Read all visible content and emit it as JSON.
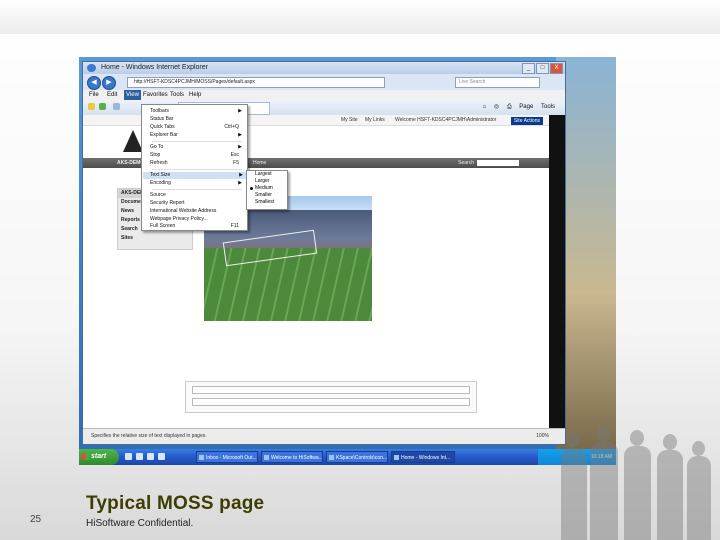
{
  "slide": {
    "title": "Typical MOSS page",
    "number": "25",
    "footer": "HiSoftware Confidential."
  },
  "browser": {
    "title": "Home - Windows Internet Explorer",
    "address": "http://HSFT-KDSC4PCJMH/MOSS/Pages/default.aspx",
    "search_placeholder": "Live Search",
    "window_buttons": [
      "_",
      "□",
      "X"
    ],
    "menubar": [
      "File",
      "Edit",
      "View",
      "Favorites",
      "Tools",
      "Help"
    ],
    "active_menu": "View",
    "toolbar": {
      "page": "Page",
      "tools": "Tools"
    },
    "status_text": "Specifies the relative size of text displayed in pages.",
    "zoom": "100%"
  },
  "view_menu": {
    "items": [
      {
        "label": "Toolbars",
        "shortcut": "",
        "arrow": "▶"
      },
      {
        "label": "Status Bar",
        "shortcut": "",
        "arrow": ""
      },
      {
        "label": "Quick Tabs",
        "shortcut": "Ctrl+Q",
        "arrow": ""
      },
      {
        "label": "Explorer Bar",
        "shortcut": "",
        "arrow": "▶"
      },
      {
        "label": "Go To",
        "shortcut": "",
        "arrow": "▶"
      },
      {
        "label": "Stop",
        "shortcut": "Esc",
        "arrow": ""
      },
      {
        "label": "Refresh",
        "shortcut": "F5",
        "arrow": ""
      },
      {
        "label": "Text Size",
        "shortcut": "",
        "arrow": "▶"
      },
      {
        "label": "Encoding",
        "shortcut": "",
        "arrow": "▶"
      },
      {
        "label": "Source",
        "shortcut": "",
        "arrow": ""
      },
      {
        "label": "Security Report",
        "shortcut": "",
        "arrow": ""
      },
      {
        "label": "International Website Address",
        "shortcut": "",
        "arrow": ""
      },
      {
        "label": "Webpage Privacy Policy...",
        "shortcut": "",
        "arrow": ""
      },
      {
        "label": "Full Screen",
        "shortcut": "F11",
        "arrow": ""
      }
    ],
    "text_size_options": [
      "Largest",
      "Larger",
      "Medium",
      "Smaller",
      "Smallest"
    ],
    "selected_text_size": "Medium"
  },
  "sharepoint": {
    "top_links": [
      "My Site",
      "My Links",
      "Welcome HSFT-KDSC4PCJMH\\Administrator",
      "Site Actions"
    ],
    "nav_items": [
      "Home",
      "Document Center",
      "News",
      "Reports",
      "Search",
      "Sites"
    ],
    "quick_launch": [
      "AKS-DEMO",
      "Document",
      "News",
      "Reports",
      "Search",
      "Sites"
    ],
    "search_label": "Search"
  },
  "taskbar": {
    "start": "start",
    "items": [
      "Inbox - Microsoft Out...",
      "Welcome to HiSoftwa...",
      "KSpace\\Controls\\con...",
      "Home - Windows Int..."
    ],
    "clock": "10:18 AM"
  }
}
